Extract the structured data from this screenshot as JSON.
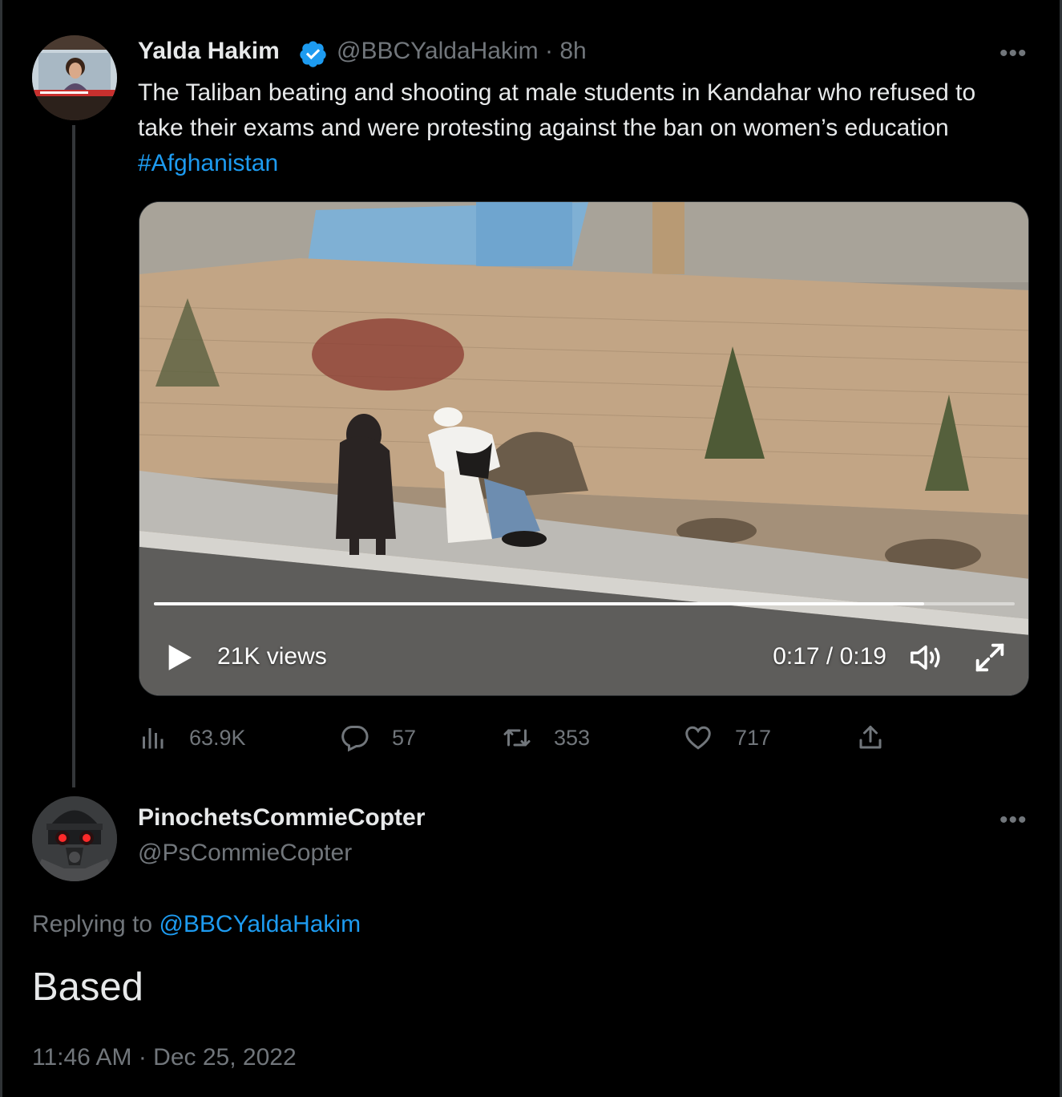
{
  "tweet": {
    "author_name": "Yalda Hakim",
    "author_handle": "@BBCYaldaHakim",
    "time_ago": "8h",
    "text": "The Taliban beating and shooting at male students in Kandahar who refused to take their exams and were protesting against the ban on women’s education ",
    "hashtag": "#Afghanistan",
    "more_label": "•••",
    "video": {
      "views": "21K views",
      "time": "0:17 / 0:19",
      "progress": 0.895
    },
    "stats": {
      "views": "63.9K",
      "replies": "57",
      "retweets": "353",
      "likes": "717"
    }
  },
  "reply": {
    "author_name": "PinochetsCommieCopter",
    "author_handle": "@PsCommieCopter",
    "more_label": "•••",
    "replying_prefix": "Replying to ",
    "replying_handle": "@BBCYaldaHakim",
    "text": "Based",
    "timestamp": "11:46 AM · Dec 25, 2022"
  },
  "colors": {
    "background": "#000000",
    "text": "#e7e9ea",
    "muted": "#71767b",
    "link": "#1d9bf0",
    "verified": "#1d9bf0"
  },
  "icons": [
    "verified-badge-icon",
    "more-icon",
    "play-icon",
    "volume-icon",
    "fullscreen-icon",
    "views-chart-icon",
    "reply-icon",
    "retweet-icon",
    "like-icon",
    "share-icon"
  ]
}
